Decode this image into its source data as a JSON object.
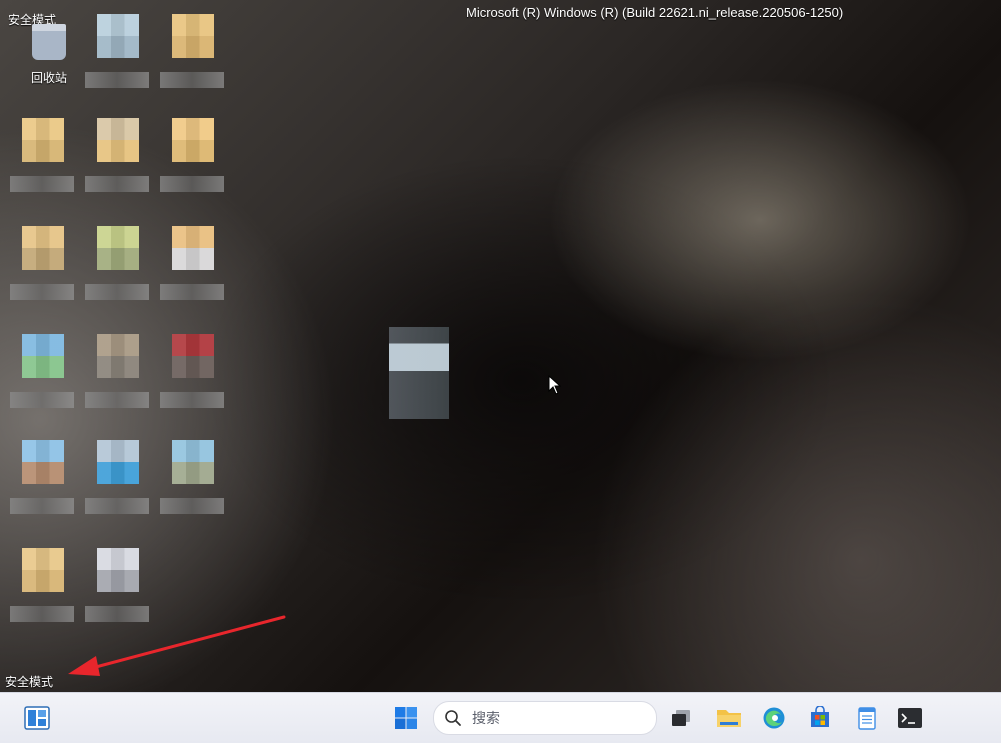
{
  "desktop": {
    "safe_mode_label": "安全模式",
    "build_info": "Microsoft (R) Windows (R) (Build 22621.ni_release.220506-1250)",
    "recycle_bin_label": "回收站"
  },
  "taskbar": {
    "search_placeholder": "搜索"
  },
  "colors": {
    "annotation_arrow": "#e8262c",
    "taskbar_bg": "#eceef5",
    "windows_logo": "#1e7be6"
  }
}
